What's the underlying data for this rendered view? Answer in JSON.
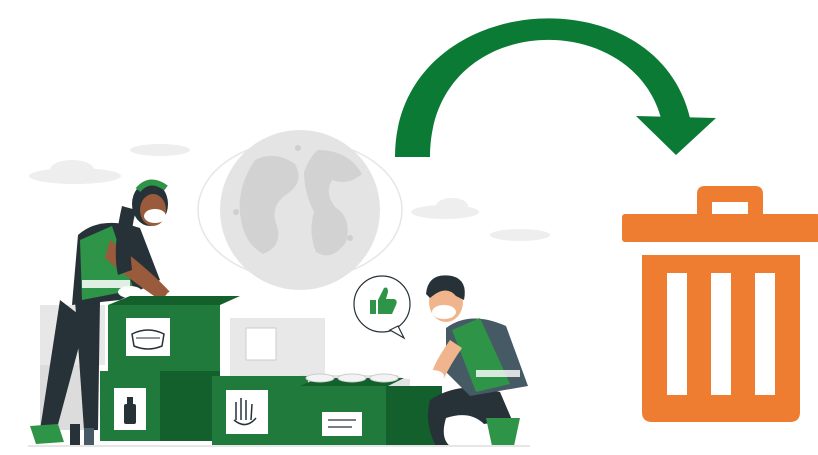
{
  "colors": {
    "arrow": "#0a7a35",
    "trash": "#ee7d31",
    "box_green": "#1f7a3c",
    "box_green_dark": "#14602d",
    "vest": "#2e9448",
    "grey_light": "#ececec",
    "grey_mid": "#d8d8d8",
    "skin": "#9a5b3c",
    "skin_light": "#f1b58e",
    "dark": "#263238"
  },
  "icons": {
    "arrow": "curved-arrow-icon",
    "trash": "trash-can-icon",
    "thumbs": "thumbs-up-icon",
    "mask": "face-mask-icon",
    "gloves": "gloves-icon",
    "sanitizer": "sanitizer-bottle-icon",
    "globe": "globe-icon"
  }
}
